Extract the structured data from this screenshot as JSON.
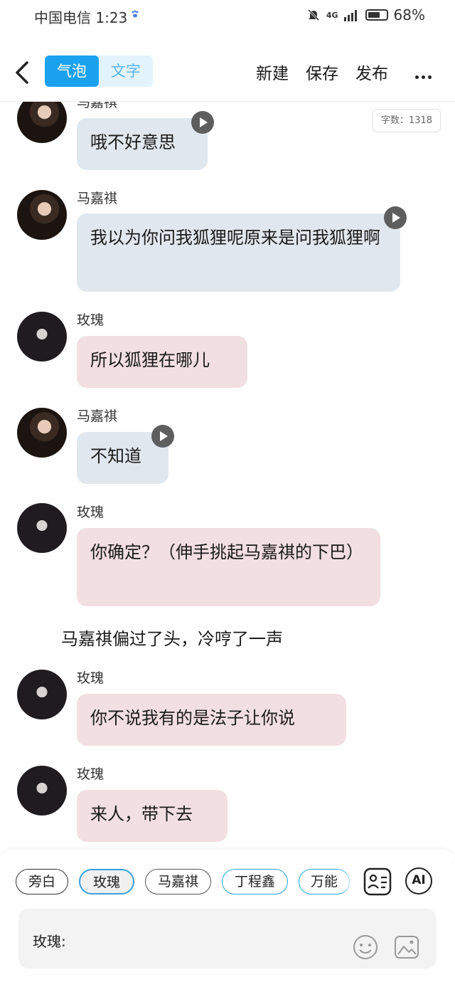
{
  "status_bar": {
    "carrier_time": "中国电信 1:23",
    "network": "4G",
    "battery": "68%",
    "battery_level": 0.68
  },
  "header": {
    "mode_bubble": "气泡",
    "mode_text": "文字",
    "actions": [
      "新建",
      "保存",
      "发布"
    ]
  },
  "word_count": "字数：1318",
  "messages": [
    {
      "sender": "马嘉祺",
      "text": "哦不好意思"
    },
    {
      "sender": "马嘉祺",
      "text": "我以为你问我狐狸呢原来是问我狐狸啊"
    },
    {
      "sender": "玫瑰",
      "text": "所以狐狸在哪儿"
    },
    {
      "sender": "马嘉祺",
      "text": "不知道"
    },
    {
      "sender": "玫瑰",
      "text": "你确定？（伸手挑起马嘉祺的下巴）"
    },
    {
      "sender": "玫瑰",
      "text": "你不说我有的是法子让你说"
    },
    {
      "sender": "玫瑰",
      "text": "来人，带下去"
    }
  ],
  "narration": "马嘉祺偏过了头，冷哼了一声",
  "role_chips": [
    "旁白",
    "玫瑰",
    "马嘉祺",
    "丁程鑫",
    "万能"
  ],
  "ai_label": "AI",
  "input": {
    "label": "玫瑰:"
  }
}
